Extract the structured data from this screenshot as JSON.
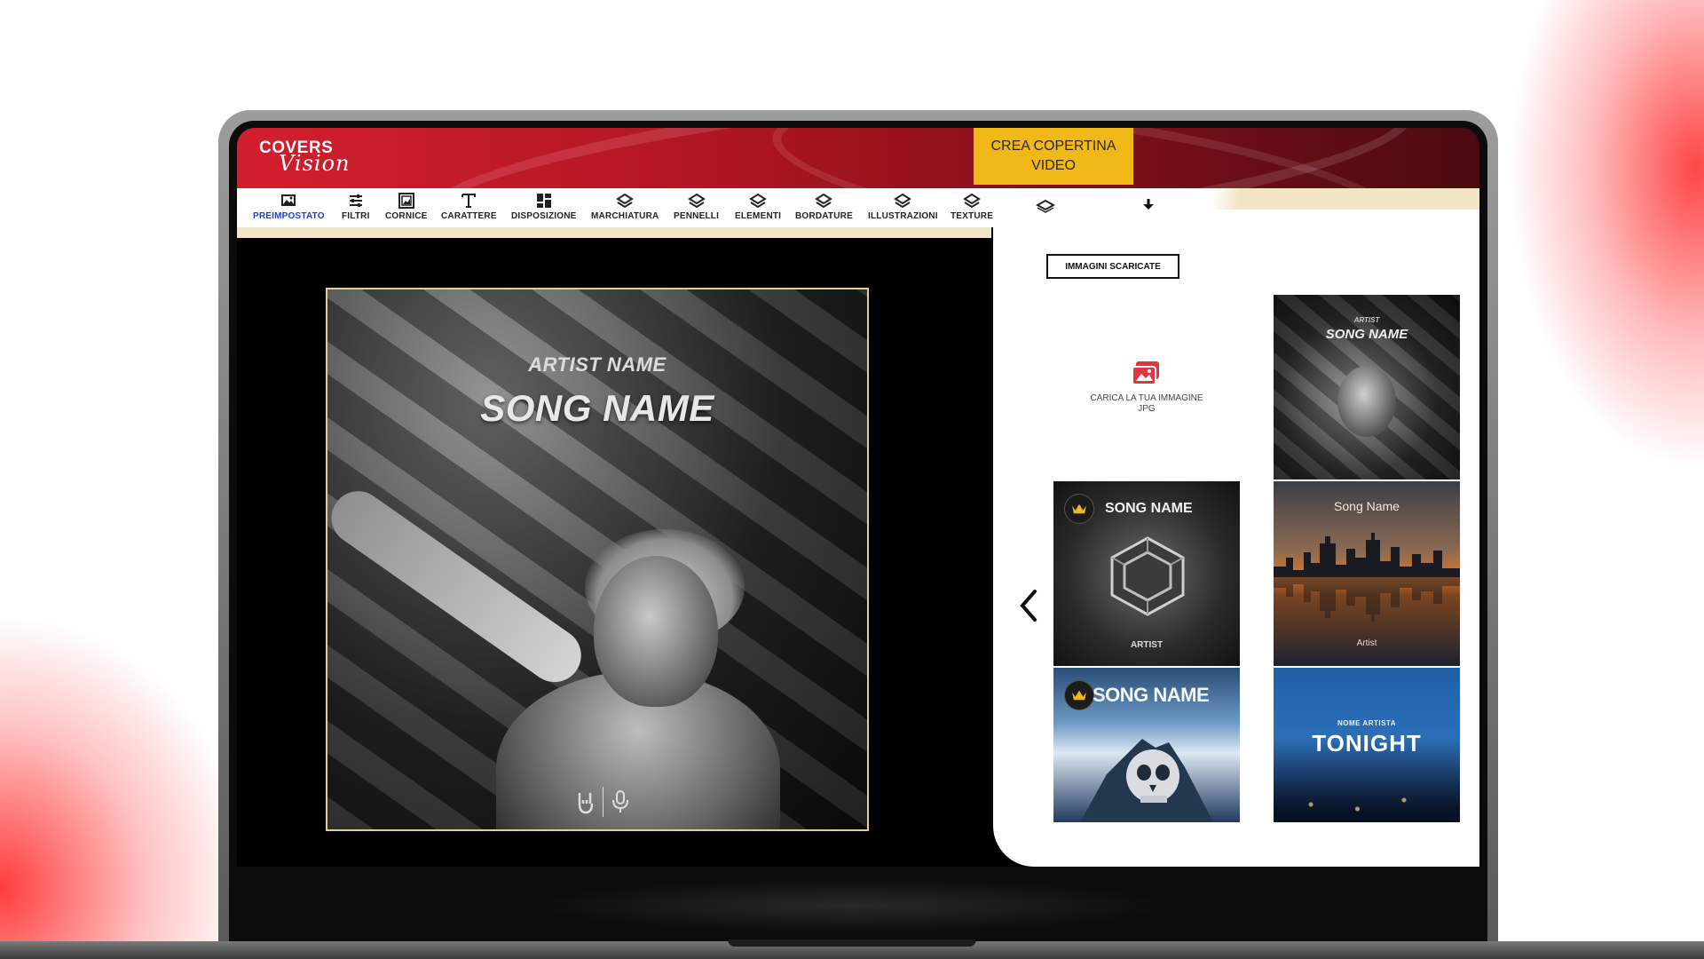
{
  "app": {
    "logo_top": "COVERS",
    "logo_bottom": "Vision",
    "cta_label": "CREA COPERTINA VIDEO"
  },
  "toolbar": {
    "items": [
      {
        "label": "PREIMPOSTATO",
        "icon": "image-icon",
        "active": true
      },
      {
        "label": "FILTRI",
        "icon": "sliders-icon",
        "active": false
      },
      {
        "label": "CORNICE",
        "icon": "frame-icon",
        "active": false
      },
      {
        "label": "CARATTERE",
        "icon": "text-icon",
        "active": false
      },
      {
        "label": "DISPOSIZIONE",
        "icon": "grid-icon",
        "active": false
      },
      {
        "label": "MARCHIATURA",
        "icon": "layers-icon",
        "active": false
      },
      {
        "label": "PENNELLI",
        "icon": "layers-icon",
        "active": false
      },
      {
        "label": "ELEMENTI",
        "icon": "layers-icon",
        "active": false
      },
      {
        "label": "BORDATURE",
        "icon": "layers-icon",
        "active": false
      },
      {
        "label": "ILLUSTRAZIONI",
        "icon": "layers-icon",
        "active": false
      },
      {
        "label": "TEXTURE",
        "icon": "layers-icon",
        "active": false
      }
    ],
    "accent_active": "#1f3fbf"
  },
  "cover": {
    "artist_name": "ARTIST NAME",
    "song_name": "SONG NAME",
    "border_color": "#e3cf96"
  },
  "panel": {
    "downloaded_button": "IMMAGINI SCARICATE",
    "upload_text_line1": "CARICA LA TUA IMMAGINE",
    "upload_text_line2": "JPG",
    "templates": [
      {
        "artist": "ARTIST",
        "song": "SONG NAME"
      },
      {
        "song": "SONG NAME",
        "artist": "ARTIST"
      },
      {
        "song": "Song Name",
        "artist": "Artist"
      },
      {
        "song": "SONG NAME"
      },
      {
        "artist": "NOME ARTISTA",
        "song": "TONIGHT"
      }
    ]
  },
  "colors": {
    "brand_red": "#d21f2d",
    "cta_yellow": "#f1b918",
    "cream": "#f2e6c8"
  }
}
